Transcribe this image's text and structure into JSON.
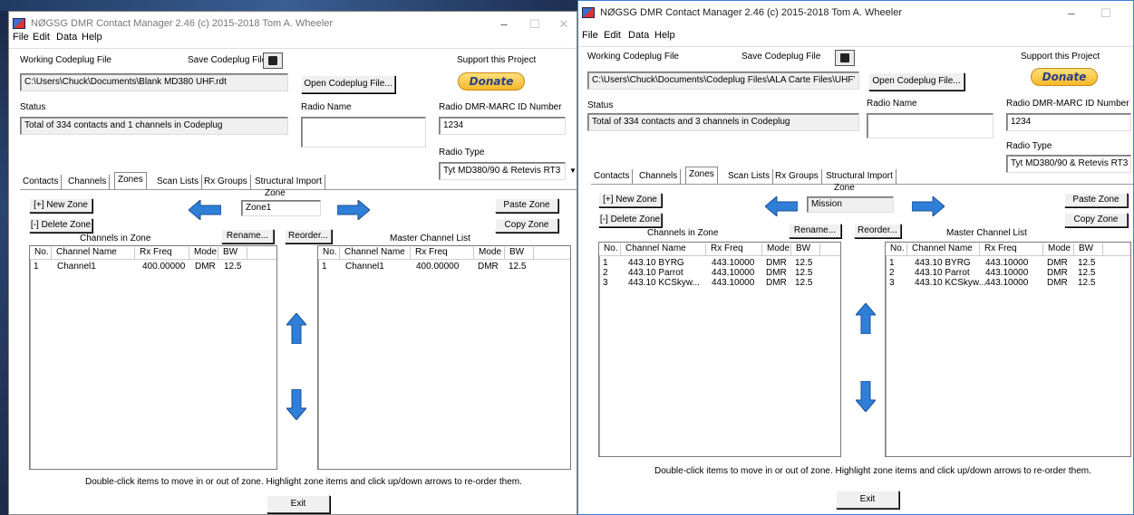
{
  "windows": [
    {
      "title": "NØGSG DMR Contact Manager 2.46 (c) 2015-2018 Tom A. Wheeler",
      "menu": [
        "File",
        "Edit",
        "Data",
        "Help"
      ],
      "working_codeplug_label": "Working Codeplug File",
      "save_codeplug_label": "Save Codeplug File",
      "support_label": "Support this Project",
      "donate_label": "Donate",
      "codeplug_path": "C:\\Users\\Chuck\\Documents\\Blank MD380 UHF.rdt",
      "open_codeplug_label": "Open Codeplug File...",
      "status_label": "Status",
      "status_text": "Total of 334 contacts and 1 channels in Codeplug",
      "radio_name_label": "Radio Name",
      "radio_name_value": "",
      "radio_id_label": "Radio DMR-MARC ID Number",
      "radio_id_value": "1234",
      "radio_type_label": "Radio Type",
      "radio_type_value": "Tyt MD380/90 & Retevis RT3",
      "tabs": [
        "Contacts",
        "Channels",
        "Zones",
        "Scan Lists",
        "Rx Groups",
        "Structural Import"
      ],
      "zone_label": "Zone",
      "zone_value": "Zone1",
      "new_zone_label": "[+] New Zone",
      "delete_zone_label": "[-] Delete Zone",
      "paste_zone_label": "Paste Zone",
      "copy_zone_label": "Copy Zone",
      "channels_in_zone_label": "Channels in Zone",
      "rename_label": "Rename...",
      "reorder_label": "Reorder...",
      "master_list_label": "Master Channel List",
      "columns": [
        "No.",
        "Channel Name",
        "Rx Freq",
        "Mode",
        "BW"
      ],
      "zone_rows": [
        [
          "1",
          "Channel1",
          "400.00000",
          "DMR",
          "12.5"
        ]
      ],
      "master_rows": [
        [
          "1",
          "Channel1",
          "400.00000",
          "DMR",
          "12.5"
        ]
      ],
      "hint": "Double-click items to move in or out of zone. Highlight zone items and click up/down arrows to re-order them.",
      "exit_label": "Exit"
    },
    {
      "title": "NØGSG DMR Contact Manager 2.46 (c) 2015-2018 Tom A. Wheeler",
      "menu": [
        "File",
        "Edit",
        "Data",
        "Help"
      ],
      "working_codeplug_label": "Working Codeplug File",
      "save_codeplug_label": "Save Codeplug File",
      "support_label": "Support this Project",
      "donate_label": "Donate",
      "codeplug_path": "C:\\Users\\Chuck\\Documents\\Codeplug Files\\ALA Carte Files\\UHF'",
      "open_codeplug_label": "Open Codeplug File...",
      "status_label": "Status",
      "status_text": "Total of 334 contacts and 3 channels in Codeplug",
      "radio_name_label": "Radio Name",
      "radio_name_value": "",
      "radio_id_label": "Radio DMR-MARC ID Number",
      "radio_id_value": "1234",
      "radio_type_label": "Radio Type",
      "radio_type_value": "Tyt MD380/90 & Retevis RT3",
      "tabs": [
        "Contacts",
        "Channels",
        "Zones",
        "Scan Lists",
        "Rx Groups",
        "Structural Import"
      ],
      "zone_label": "Zone",
      "zone_value": "Mission",
      "new_zone_label": "[+] New Zone",
      "delete_zone_label": "[-] Delete Zone",
      "paste_zone_label": "Paste Zone",
      "copy_zone_label": "Copy Zone",
      "channels_in_zone_label": "Channels in Zone",
      "rename_label": "Rename...",
      "reorder_label": "Reorder...",
      "master_list_label": "Master Channel List",
      "columns": [
        "No.",
        "Channel Name",
        "Rx Freq",
        "Mode",
        "BW"
      ],
      "zone_rows": [
        [
          "1",
          "443.10 BYRG",
          "443.10000",
          "DMR",
          "12.5"
        ],
        [
          "2",
          "443.10 Parrot",
          "443.10000",
          "DMR",
          "12.5"
        ],
        [
          "3",
          "443.10 KCSkyw...",
          "443.10000",
          "DMR",
          "12.5"
        ]
      ],
      "master_rows": [
        [
          "1",
          "443.10 BYRG",
          "443.10000",
          "DMR",
          "12.5"
        ],
        [
          "2",
          "443.10 Parrot",
          "443.10000",
          "DMR",
          "12.5"
        ],
        [
          "3",
          "443.10 KCSkyw...",
          "443.10000",
          "DMR",
          "12.5"
        ]
      ],
      "hint": "Double-click items to move in or out of zone. Highlight zone items and click up/down arrows to re-order them.",
      "exit_label": "Exit"
    }
  ],
  "colors": {
    "arrow_blue": "#2f7fd8",
    "donate_gold": "#f5b82a",
    "donate_text": "#2a3f86",
    "desktop": "#1f3358"
  },
  "icons": [
    "app-icon",
    "save-disk-icon",
    "left-arrow-icon",
    "right-arrow-icon",
    "up-arrow-icon",
    "down-arrow-icon",
    "minimize-icon",
    "maximize-icon",
    "close-icon"
  ]
}
